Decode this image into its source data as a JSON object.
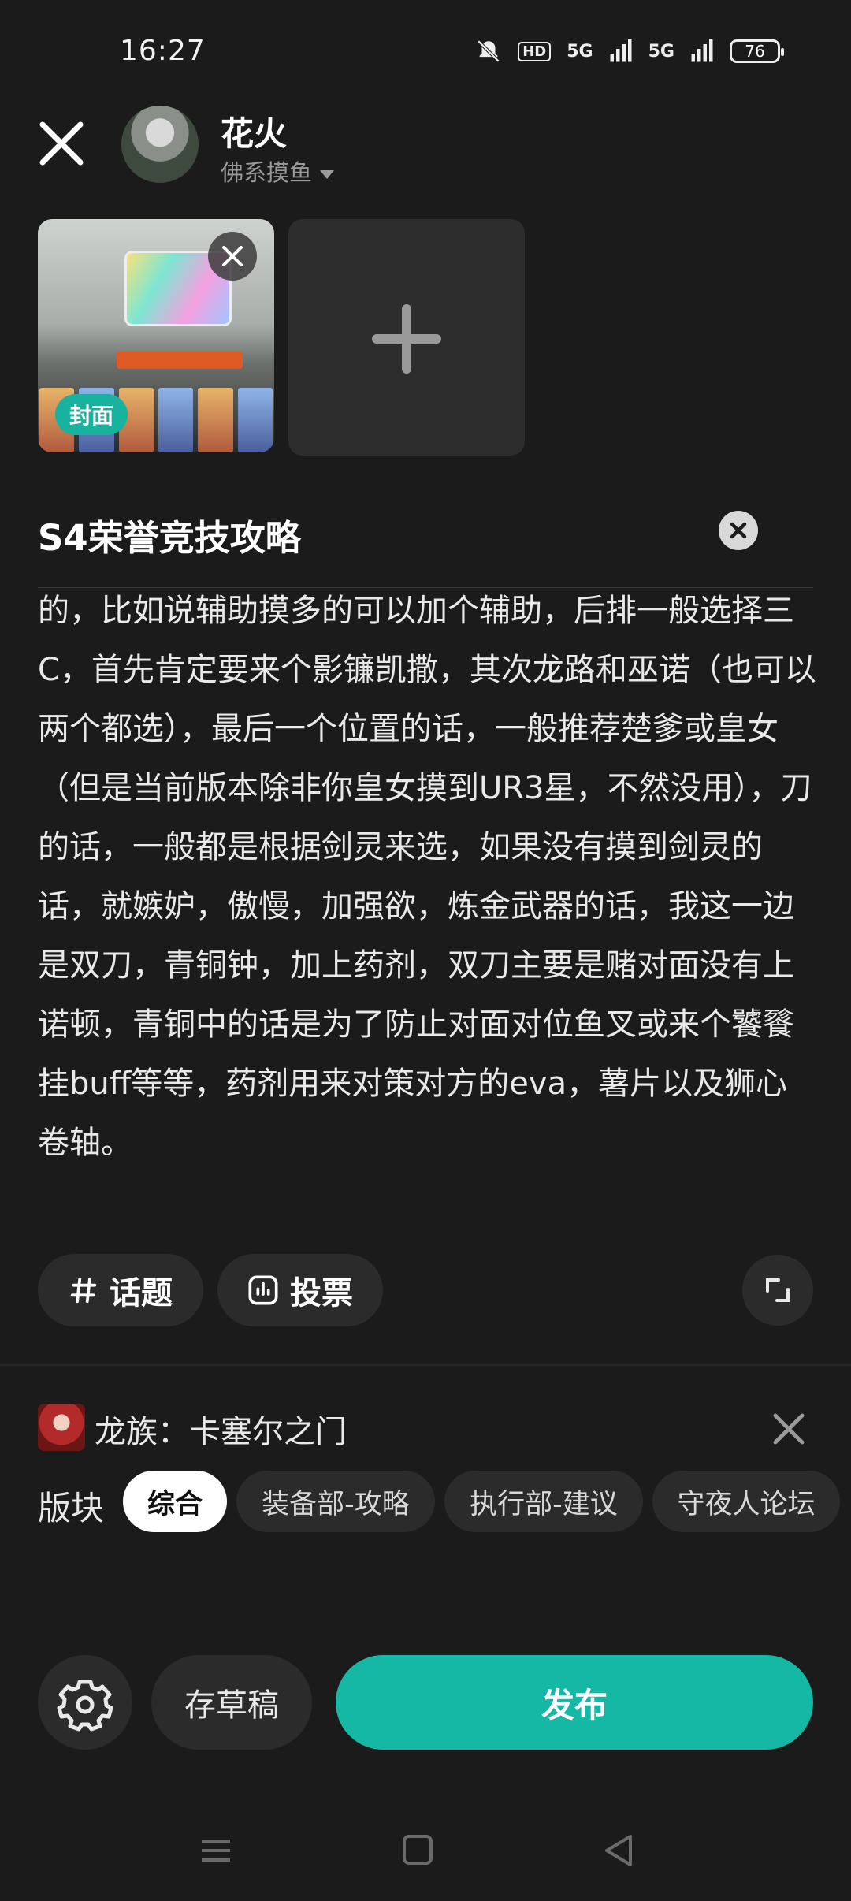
{
  "status_bar": {
    "time": "16:27",
    "battery": "76",
    "signal1": "5G",
    "signal2": "5G",
    "hd": "HD"
  },
  "header": {
    "user_name": "花火",
    "user_status": "佛系摸鱼"
  },
  "media": {
    "cover_label": "封面"
  },
  "post": {
    "title": "S4荣誉竞技攻略",
    "body": "的，比如说辅助摸多的可以加个辅助，后排一般选择三C，首先肯定要来个影镰凯撒，其次龙路和巫诺（也可以两个都选），最后一个位置的话，一般推荐楚爹或皇女（但是当前版本除非你皇女摸到UR3星，不然没用），刀的话，一般都是根据剑灵来选，如果没有摸到剑灵的话，就嫉妒，傲慢，加强欲，炼金武器的话，我这一边是双刀，青铜钟，加上药剂，双刀主要是赌对面没有上诺顿，青铜中的话是为了防止对面对位鱼叉或来个饕餮挂buff等等，药剂用来对策对方的eva，薯片以及狮心卷轴。"
  },
  "tools": {
    "topic_label": "话题",
    "vote_label": "投票"
  },
  "community": {
    "name": "龙族：卡塞尔之门",
    "board_label": "版块",
    "boards": [
      "综合",
      "装备部-攻略",
      "执行部-建议",
      "守夜人论坛"
    ]
  },
  "actions": {
    "draft_label": "存草稿",
    "publish_label": "发布"
  },
  "colors": {
    "accent": "#14b8a4",
    "background": "#1b1b1b"
  }
}
